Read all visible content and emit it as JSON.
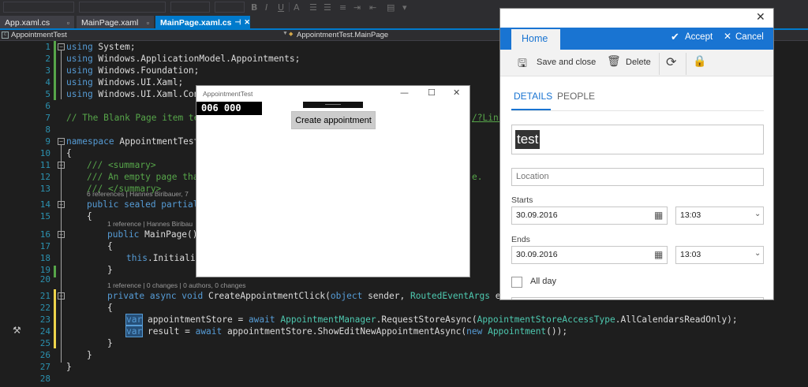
{
  "toolbar": {
    "bold": "B",
    "italic": "I",
    "underline": "U",
    "font_color": "A"
  },
  "tabs": [
    {
      "label": "App.xaml.cs",
      "active": false
    },
    {
      "label": "MainPage.xaml",
      "active": false
    },
    {
      "label": "MainPage.xaml.cs",
      "active": true
    }
  ],
  "nav": {
    "project": "AppointmentTest",
    "member": "AppointmentTest.MainPage"
  },
  "code": {
    "l1_kw": "using",
    "l1_rest": " System;",
    "l2_kw": "using",
    "l2_rest": " Windows.ApplicationModel.Appointments;",
    "l3_kw": "using",
    "l3_rest": " Windows.Foundation;",
    "l4_kw": "using",
    "l4_rest": " Windows.UI.Xaml;",
    "l5_kw": "using",
    "l5_rest": " Windows.UI.Xaml.Cont",
    "l7_comment": "// The Blank Page item ter",
    "l7_link": "/?Link",
    "l9_kw": "namespace",
    "l9_rest": " AppointmentTest",
    "l10": "{",
    "l11": "/// <summary>",
    "l12": "/// An empty page that",
    "l12_tail": "e.",
    "l13": "/// </summary>",
    "lens_class": "6 references | Hannes Biribauer, 7",
    "l14_kw": "public sealed partial",
    "l15": "{",
    "lens_ctor": "1 reference | Hannes Biribau",
    "l16_kw": "public",
    "l16_rest": " MainPage()",
    "l17": "{",
    "l18_kw": "this",
    "l18_rest": ".Initializ",
    "l19": "}",
    "lens_method": "1 reference | 0 changes | 0 authors, 0 changes",
    "l21_kw": "private async void",
    "l21_name": " CreateAppointmentClick(",
    "l21_kw2": "object",
    "l21_mid": " sender, ",
    "l21_type": "RoutedEventArgs",
    "l21_end": " e)",
    "l22": "{",
    "l23_var": "var",
    "l23_a": " appointmentStore = ",
    "l23_await": "await",
    "l23_sp": " ",
    "l23_type": "AppointmentManager",
    "l23_b": ".RequestStoreAsync(",
    "l23_type2": "AppointmentStoreAccessType",
    "l23_c": ".AllCalendarsReadOnly);",
    "l24_var": "var",
    "l24_a": " result = ",
    "l24_await": "await",
    "l24_b": " appointmentStore.ShowEditNewAppointmentAsync(",
    "l24_new": "new",
    "l24_sp": " ",
    "l24_type": "Appointment",
    "l24_c": "());",
    "l25": "}",
    "l26": "}",
    "l27": "}"
  },
  "line_numbers": [
    "1",
    "2",
    "3",
    "4",
    "5",
    "6",
    "7",
    "8",
    "9",
    "10",
    "11",
    "12",
    "13",
    "14",
    "15",
    "16",
    "17",
    "18",
    "19",
    "20",
    "21",
    "22",
    "23",
    "24",
    "25",
    "26",
    "27",
    "28"
  ],
  "app_window": {
    "title": "AppointmentTest",
    "counter": "006  000",
    "button": "Create appointment",
    "minimize": "—",
    "maximize": "☐",
    "close": "✕"
  },
  "dialog": {
    "close": "✕",
    "home_tab": "Home",
    "accept": "Accept",
    "cancel": "Cancel",
    "save_close": "Save and close",
    "delete": "Delete",
    "pivot_details": "DETAILS",
    "pivot_people": "PEOPLE",
    "title_value": "test",
    "location_placeholder": "Location",
    "starts_label": "Starts",
    "start_date": "30.09.2016",
    "start_time": "13:03",
    "ends_label": "Ends",
    "end_date": "30.09.2016",
    "end_time": "13:03",
    "all_day": "All day"
  },
  "colors": {
    "accent": "#1974d2",
    "vs_blue": "#007acc",
    "keyword": "#569cd6",
    "type": "#4ec9b0",
    "comment": "#57a64a"
  }
}
